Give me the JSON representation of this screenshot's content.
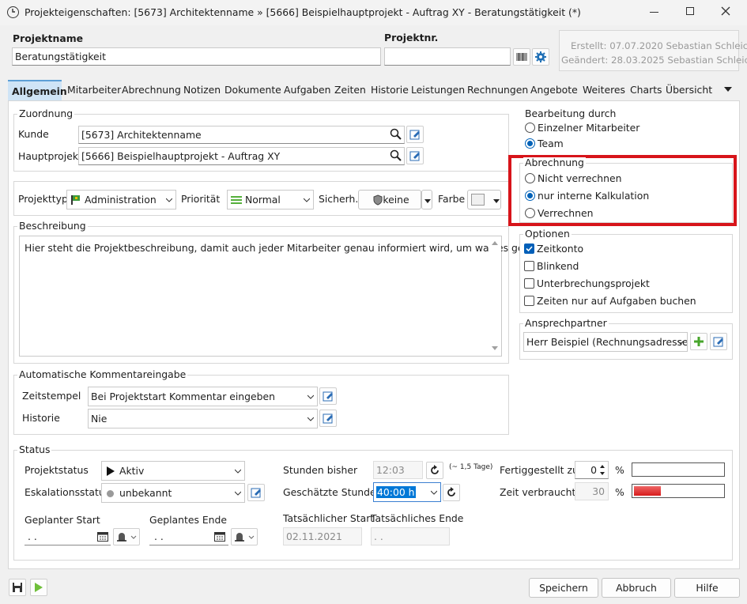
{
  "window": {
    "title": "Projekteigenschaften: [5673] Architektenname » [5666] Beispielhauptprojekt - Auftrag XY - Beratungstätigkeit (*)"
  },
  "header": {
    "name_label": "Projektname",
    "name_value": "Beratungstätigkeit",
    "nr_label": "Projektnr.",
    "nr_value": "",
    "created": "Erstellt: 07.07.2020 Sebastian Schleic...",
    "changed": "Geändert: 28.03.2025 Sebastian Schleic..."
  },
  "tabs": [
    "Allgemein",
    "Mitarbeiter",
    "Abrechnung",
    "Notizen",
    "Dokumente",
    "Aufgaben",
    "Zeiten",
    "Historie",
    "Leistungen",
    "Rechnungen",
    "Angebote",
    "Weiteres",
    "Charts",
    "Übersicht"
  ],
  "zuordnung": {
    "title": "Zuordnung",
    "kunde_label": "Kunde",
    "kunde_value": "[5673] Architektenname",
    "haupt_label": "Hauptprojekt",
    "haupt_value": "[5666] Beispielhauptprojekt - Auftrag XY"
  },
  "typ": {
    "label": "Projekttyp",
    "value": "Administration",
    "prio_label": "Priorität",
    "prio_value": "Normal",
    "sicher_label": "Sicherh.",
    "sicher_value": "keine",
    "farbe_label": "Farbe"
  },
  "beschreibung": {
    "title": "Beschreibung",
    "text": "Hier steht die Projektbeschreibung, damit auch jeder Mitarbeiter genau informiert wird, um was es geht."
  },
  "kommentar": {
    "title": "Automatische Kommentareingabe",
    "zeit_label": "Zeitstempel",
    "zeit_value": "Bei Projektstart Kommentar eingeben",
    "hist_label": "Historie",
    "hist_value": "Nie"
  },
  "bearbeitung": {
    "title": "Bearbeitung durch",
    "opt1": "Einzelner Mitarbeiter",
    "opt2": "Team",
    "selected": "Team"
  },
  "abrechnung": {
    "title": "Abrechnung",
    "opt1": "Nicht verrechnen",
    "opt2": "nur interne Kalkulation",
    "opt3": "Verrechnen",
    "selected": "nur interne Kalkulation",
    "highlight_color": "#d7141a"
  },
  "optionen": {
    "title": "Optionen",
    "items": [
      "Zeitkonto",
      "Blinkend",
      "Unterbrechungsprojekt",
      "Zeiten nur auf Aufgaben buchen"
    ],
    "checked": [
      "Zeitkonto"
    ]
  },
  "ansprech": {
    "title": "Ansprechpartner",
    "value": "Herr Beispiel (Rechnungsadresse)"
  },
  "status": {
    "title": "Status",
    "projektstatus_label": "Projektstatus",
    "projektstatus_value": "Aktiv",
    "eskal_label": "Eskalationsstatus",
    "eskal_value": "unbekannt",
    "stunden_label": "Stunden bisher",
    "stunden_value": "12:03",
    "stunden_note": "(~ 1,5 Tage)",
    "geschaetzt_label": "Geschätzte Stunden",
    "geschaetzt_value": "40:00 h",
    "fertig_label": "Fertiggestellt zu",
    "fertig_value": "0",
    "pct": "%",
    "verbraucht_label": "Zeit verbraucht",
    "verbraucht_value": "30",
    "verbraucht_fraction": 0.3,
    "gep_start_label": "Geplanter Start",
    "gep_start_value": " .  .",
    "gep_ende_label": "Geplantes Ende",
    "gep_ende_value": " .  .",
    "tat_start_label": "Tatsächlicher Start",
    "tat_start_value": "02.11.2021",
    "tat_ende_label": "Tatsächliches Ende",
    "tat_ende_value": " .  ."
  },
  "footer": {
    "save": "Speichern",
    "cancel": "Abbruch",
    "help": "Hilfe"
  }
}
